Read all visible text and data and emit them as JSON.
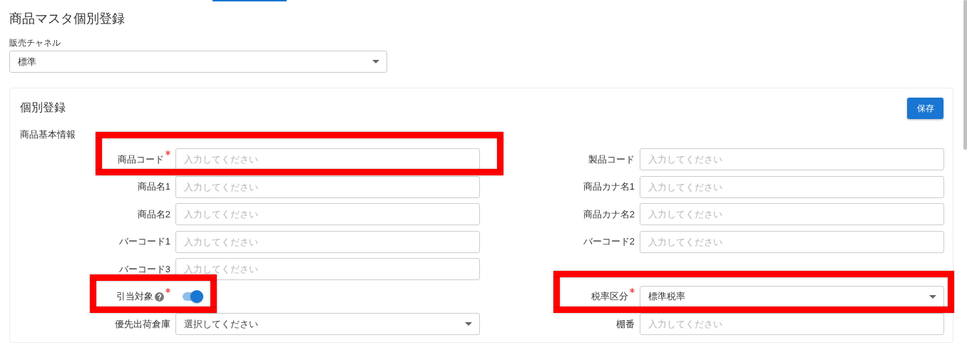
{
  "page_title": "商品マスタ個別登録",
  "sales_channel": {
    "label": "販売チャネル",
    "value": "標準"
  },
  "card": {
    "title": "個別登録",
    "save_button": "保存",
    "section_title": "商品基本情報",
    "rows": [
      {
        "left": {
          "kind": "text",
          "label": "商品コード",
          "required": true,
          "placeholder": "入力してください",
          "highlighted": true
        },
        "right": {
          "kind": "text",
          "label": "製品コード",
          "placeholder": "入力してください"
        }
      },
      {
        "left": {
          "kind": "text",
          "label": "商品名1",
          "placeholder": "入力してください"
        },
        "right": {
          "kind": "text",
          "label": "商品カナ名1",
          "placeholder": "入力してください"
        }
      },
      {
        "left": {
          "kind": "text",
          "label": "商品名2",
          "placeholder": "入力してください"
        },
        "right": {
          "kind": "text",
          "label": "商品カナ名2",
          "placeholder": "入力してください"
        }
      },
      {
        "left": {
          "kind": "text",
          "label": "バーコード1",
          "placeholder": "入力してください"
        },
        "right": {
          "kind": "text",
          "label": "バーコード2",
          "placeholder": "入力してください"
        }
      },
      {
        "left": {
          "kind": "text",
          "label": "バーコード3",
          "placeholder": "入力してください"
        }
      },
      {
        "left": {
          "kind": "toggle",
          "label": "引当対象",
          "help": true,
          "required": true,
          "on": true,
          "highlighted": true
        },
        "right": {
          "kind": "select",
          "label": "税率区分",
          "required": true,
          "value": "標準税率",
          "highlighted": true
        }
      },
      {
        "left": {
          "kind": "select",
          "label": "優先出荷倉庫",
          "placeholder": "選択してください"
        },
        "right": {
          "kind": "text",
          "label": "棚番",
          "placeholder": "入力してください"
        }
      }
    ]
  }
}
